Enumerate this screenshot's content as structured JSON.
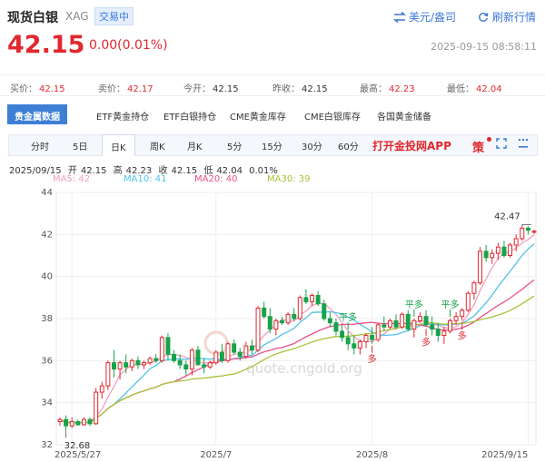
{
  "header": {
    "title": "现货白银",
    "code": "XAG",
    "status": "交易中",
    "currency_label": "美元/盎司",
    "refresh_label": "刷新行情"
  },
  "price": {
    "last": "42.15",
    "change": "0.00(0.01%)",
    "datetime": "2025-09-15 08:58:11"
  },
  "quote": [
    {
      "label": "买价：",
      "value": "42.15",
      "color": "red"
    },
    {
      "label": "卖价：",
      "value": "42.17",
      "color": "red"
    },
    {
      "label": "今开：",
      "value": "42.15",
      "color": "normal"
    },
    {
      "label": "昨收：",
      "value": "42.15",
      "color": "normal"
    },
    {
      "label": "最高：",
      "value": "42.23",
      "color": "red"
    },
    {
      "label": "最低：",
      "value": "42.04",
      "color": "red"
    }
  ],
  "tabs": [
    "贵金属数据",
    "ETF黄金持仓",
    "ETF白银持仓",
    "CME黄金库存",
    "CME白银库存",
    "各国黄金储备"
  ],
  "periods": [
    "分时",
    "5日",
    "日K",
    "周K",
    "月K",
    "5分",
    "15分",
    "30分",
    "60分"
  ],
  "active_period": "日K",
  "app_label": "打开金投网APP",
  "strategy_label": "策",
  "info": {
    "date": "2025/09/15",
    "open_label": "开",
    "open": "42.15",
    "high_label": "高",
    "high": "42.23",
    "close_label": "收",
    "close": "42.15",
    "low_label": "低",
    "low": "42.04",
    "pct": "0.01%"
  },
  "ma": [
    {
      "label": "MA5: 42",
      "color": "#f0a0c0"
    },
    {
      "label": "MA10: 41",
      "color": "#4fc3e8"
    },
    {
      "label": "MA20: 40",
      "color": "#e8508a"
    },
    {
      "label": "MA30: 39",
      "color": "#a8c23a"
    }
  ],
  "watermark": "quote.cngold.org",
  "colors": {
    "up": "#e0282e",
    "down": "#17a34a",
    "accent": "#3e7fd6"
  },
  "chart_data": {
    "type": "candlestick",
    "x_ticks": [
      "2025/5/27",
      "2025/7",
      "2025/8",
      "2025/9/15"
    ],
    "x_tick_index": [
      2,
      26,
      52,
      78
    ],
    "y_ticks": [
      32,
      34,
      36,
      38,
      40,
      42,
      44
    ],
    "ylim": [
      32,
      44
    ],
    "annotations": {
      "high": "42.47",
      "low": "32.68"
    },
    "signals": [
      {
        "index": 48,
        "text": "平多",
        "where": "above"
      },
      {
        "index": 52,
        "text": "多",
        "where": "below"
      },
      {
        "index": 59,
        "text": "平多",
        "where": "above"
      },
      {
        "index": 61,
        "text": "多",
        "where": "below"
      },
      {
        "index": 65,
        "text": "平多",
        "where": "above"
      },
      {
        "index": 67,
        "text": "多",
        "where": "below"
      }
    ],
    "candles": [
      [
        33.1,
        33.3,
        32.9,
        33.2
      ],
      [
        33.2,
        33.4,
        32.68,
        32.9
      ],
      [
        32.9,
        33.3,
        32.8,
        33.1
      ],
      [
        33.1,
        33.2,
        32.9,
        32.95
      ],
      [
        32.95,
        33.3,
        32.9,
        33.2
      ],
      [
        33.2,
        33.3,
        32.9,
        33.0
      ],
      [
        33.0,
        34.7,
        32.95,
        34.5
      ],
      [
        34.5,
        35.0,
        34.2,
        34.8
      ],
      [
        34.8,
        36.0,
        34.6,
        35.9
      ],
      [
        35.9,
        36.5,
        35.2,
        35.6
      ],
      [
        35.6,
        36.0,
        35.1,
        35.9
      ],
      [
        35.9,
        36.3,
        35.4,
        35.7
      ],
      [
        35.7,
        36.1,
        35.5,
        36.0
      ],
      [
        36.0,
        36.2,
        35.6,
        35.8
      ],
      [
        35.8,
        36.0,
        35.6,
        35.9
      ],
      [
        35.9,
        36.2,
        35.8,
        36.1
      ],
      [
        36.1,
        36.3,
        35.9,
        36.0
      ],
      [
        36.0,
        37.2,
        35.9,
        37.1
      ],
      [
        37.1,
        37.3,
        36.0,
        36.3
      ],
      [
        36.3,
        36.5,
        35.9,
        36.0
      ],
      [
        36.0,
        36.3,
        35.6,
        35.8
      ],
      [
        35.8,
        36.0,
        35.3,
        35.6
      ],
      [
        35.6,
        36.6,
        35.3,
        36.5
      ],
      [
        36.5,
        36.7,
        35.8,
        35.8
      ],
      [
        35.8,
        36.1,
        35.4,
        35.7
      ],
      [
        35.7,
        36.0,
        35.6,
        35.9
      ],
      [
        35.9,
        36.5,
        35.8,
        36.4
      ],
      [
        36.4,
        36.8,
        35.9,
        36.0
      ],
      [
        36.0,
        36.9,
        35.9,
        36.8
      ],
      [
        36.8,
        37.0,
        36.3,
        36.4
      ],
      [
        36.4,
        36.6,
        36.0,
        36.2
      ],
      [
        36.2,
        36.9,
        36.1,
        36.7
      ],
      [
        36.7,
        37.0,
        36.3,
        36.5
      ],
      [
        36.5,
        38.6,
        36.4,
        38.5
      ],
      [
        38.5,
        38.8,
        38.0,
        38.1
      ],
      [
        38.1,
        38.5,
        37.3,
        37.5
      ],
      [
        37.5,
        38.0,
        37.2,
        37.9
      ],
      [
        37.9,
        38.1,
        37.7,
        37.8
      ],
      [
        37.8,
        38.3,
        37.7,
        38.2
      ],
      [
        38.2,
        38.5,
        37.9,
        38.0
      ],
      [
        38.0,
        39.1,
        37.9,
        39.0
      ],
      [
        39.0,
        39.4,
        38.7,
        38.8
      ],
      [
        38.8,
        39.2,
        38.6,
        39.1
      ],
      [
        39.1,
        39.3,
        38.6,
        38.7
      ],
      [
        38.7,
        38.9,
        37.9,
        38.0
      ],
      [
        38.0,
        38.3,
        37.6,
        37.8
      ],
      [
        37.8,
        38.0,
        37.2,
        37.4
      ],
      [
        37.4,
        37.7,
        36.9,
        37.1
      ],
      [
        37.1,
        37.4,
        36.5,
        36.8
      ],
      [
        36.8,
        37.2,
        36.3,
        36.6
      ],
      [
        36.6,
        37.0,
        36.3,
        36.9
      ],
      [
        36.9,
        37.3,
        36.6,
        37.2
      ],
      [
        37.2,
        37.6,
        36.8,
        37.0
      ],
      [
        37.0,
        37.8,
        36.9,
        37.7
      ],
      [
        37.7,
        38.1,
        37.4,
        37.6
      ],
      [
        37.6,
        38.0,
        37.5,
        37.9
      ],
      [
        37.9,
        38.2,
        37.5,
        37.6
      ],
      [
        37.6,
        38.3,
        37.5,
        38.2
      ],
      [
        38.2,
        38.4,
        37.4,
        37.5
      ],
      [
        37.5,
        38.0,
        37.1,
        37.9
      ],
      [
        37.9,
        38.3,
        37.8,
        38.1
      ],
      [
        38.1,
        38.4,
        37.6,
        37.7
      ],
      [
        37.7,
        38.1,
        37.2,
        37.5
      ],
      [
        37.5,
        37.8,
        36.9,
        37.2
      ],
      [
        37.2,
        37.6,
        36.8,
        37.4
      ],
      [
        37.4,
        38.0,
        37.3,
        37.9
      ],
      [
        37.9,
        38.3,
        37.7,
        38.1
      ],
      [
        38.1,
        38.5,
        37.9,
        38.4
      ],
      [
        38.4,
        39.3,
        38.3,
        39.2
      ],
      [
        39.2,
        39.8,
        38.9,
        39.7
      ],
      [
        39.7,
        41.4,
        39.6,
        41.2
      ],
      [
        41.2,
        41.5,
        40.7,
        40.9
      ],
      [
        40.9,
        41.3,
        40.6,
        41.1
      ],
      [
        41.1,
        41.6,
        40.8,
        41.4
      ],
      [
        41.4,
        41.7,
        40.9,
        41.0
      ],
      [
        41.0,
        41.6,
        40.9,
        41.5
      ],
      [
        41.5,
        42.0,
        41.2,
        41.8
      ],
      [
        41.8,
        42.47,
        41.7,
        42.3
      ],
      [
        42.3,
        42.4,
        42.0,
        42.2
      ],
      [
        42.15,
        42.23,
        42.04,
        42.15
      ]
    ]
  }
}
